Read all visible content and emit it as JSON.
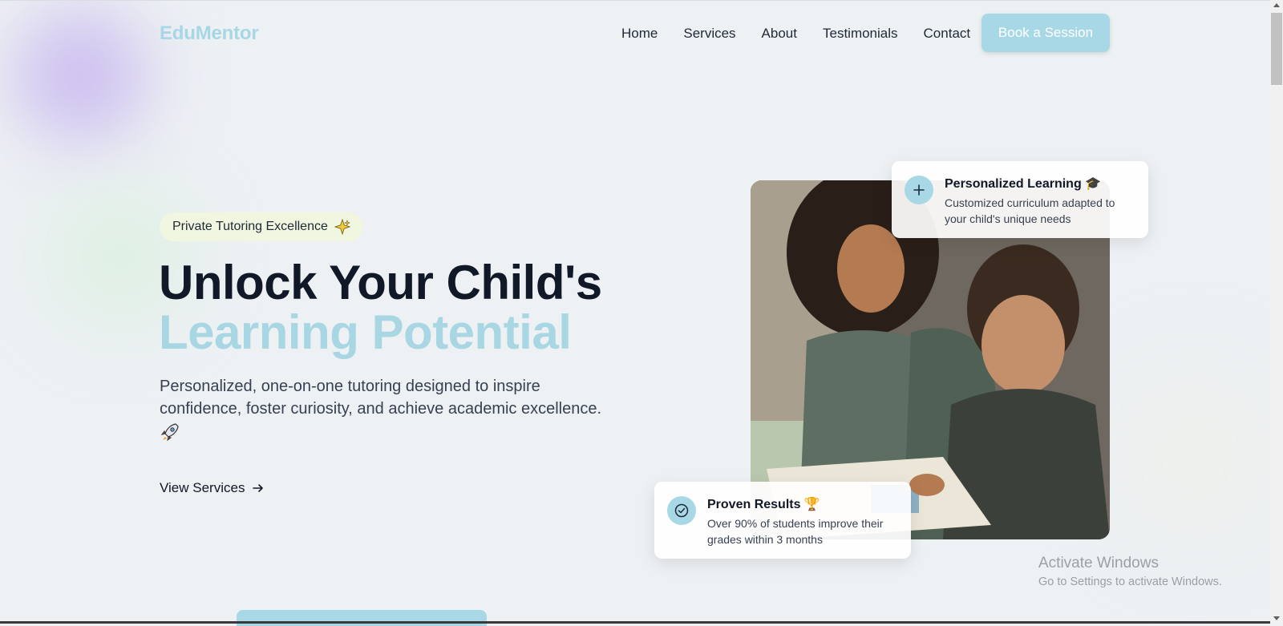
{
  "brand": {
    "name": "EduMentor"
  },
  "nav": {
    "items": [
      "Home",
      "Services",
      "About",
      "Testimonials",
      "Contact"
    ],
    "cta": "Book a Session"
  },
  "hero": {
    "badge": "Private Tutoring Excellence",
    "title_line1": "Unlock Your Child's",
    "title_line2": "Learning Potential",
    "description": "Personalized, one-on-one tutoring designed to inspire confidence, foster curiosity, and achieve academic excellence.",
    "link": "View Services"
  },
  "cards": {
    "personalized": {
      "title": "Personalized Learning 🎓",
      "text": "Customized curriculum adapted to your child's unique needs"
    },
    "results": {
      "title": "Proven Results 🏆",
      "text": "Over 90% of students improve their grades within 3 months"
    }
  },
  "watermark": {
    "line1": "Activate Windows",
    "line2": "Go to Settings to activate Windows."
  },
  "colors": {
    "accent": "#a8d8e6",
    "background": "#edf1f4",
    "heading": "#111827"
  }
}
